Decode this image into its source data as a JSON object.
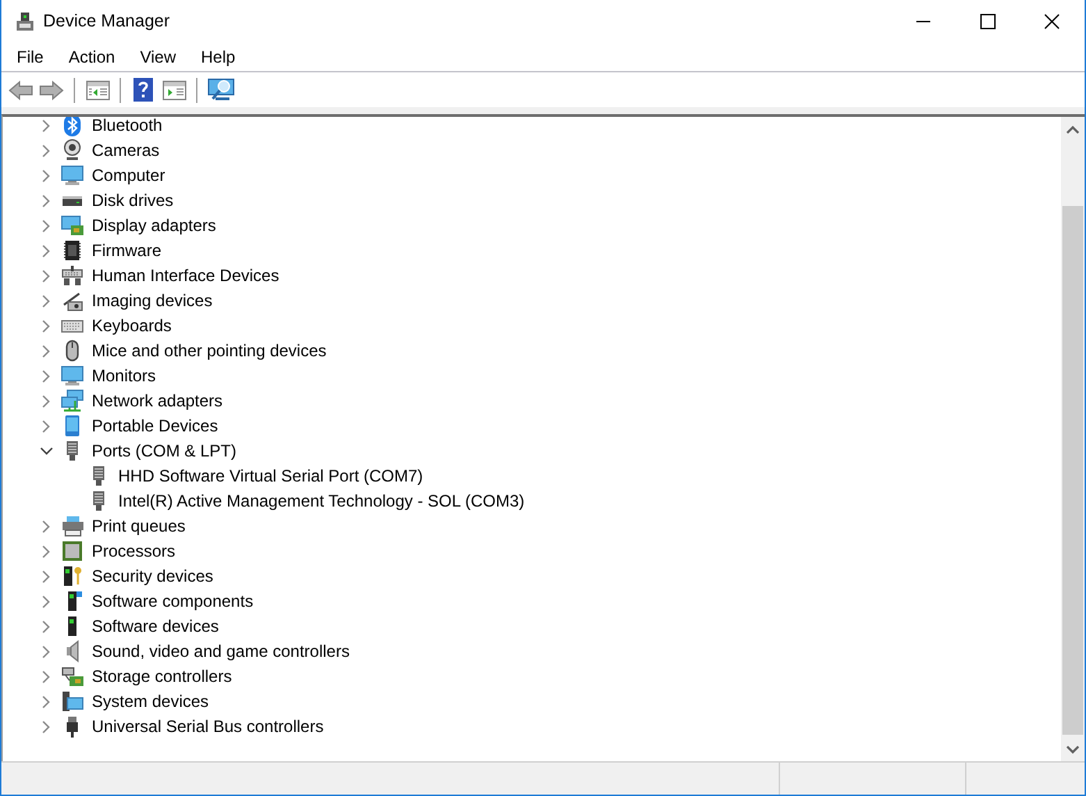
{
  "window": {
    "title": "Device Manager"
  },
  "menu": [
    "File",
    "Action",
    "View",
    "Help"
  ],
  "tree": [
    {
      "label": "Bluetooth",
      "expanded": false,
      "selected": false
    },
    {
      "label": "Cameras",
      "expanded": false,
      "selected": false
    },
    {
      "label": "Computer",
      "expanded": false,
      "selected": false
    },
    {
      "label": "Disk drives",
      "expanded": false,
      "selected": false
    },
    {
      "label": "Display adapters",
      "expanded": false,
      "selected": false
    },
    {
      "label": "Firmware",
      "expanded": false,
      "selected": false
    },
    {
      "label": "Human Interface Devices",
      "expanded": false,
      "selected": false
    },
    {
      "label": "Imaging devices",
      "expanded": false,
      "selected": false
    },
    {
      "label": "Keyboards",
      "expanded": false,
      "selected": false
    },
    {
      "label": "Mice and other pointing devices",
      "expanded": false,
      "selected": false
    },
    {
      "label": "Monitors",
      "expanded": false,
      "selected": false
    },
    {
      "label": "Network adapters",
      "expanded": false,
      "selected": false
    },
    {
      "label": "Portable Devices",
      "expanded": false,
      "selected": false
    },
    {
      "label": "Ports (COM & LPT)",
      "expanded": true,
      "selected": false,
      "children": [
        {
          "label": "HHD Software Virtual Serial Port (COM7)",
          "selected": false
        },
        {
          "label": "Intel(R) Active Management Technology - SOL (COM3)",
          "selected": false
        }
      ]
    },
    {
      "label": "Print queues",
      "expanded": false,
      "selected": false
    },
    {
      "label": "Processors",
      "expanded": false,
      "selected": false
    },
    {
      "label": "Security devices",
      "expanded": false,
      "selected": false
    },
    {
      "label": "Software components",
      "expanded": false,
      "selected": false
    },
    {
      "label": "Software devices",
      "expanded": false,
      "selected": false
    },
    {
      "label": "Sound, video and game controllers",
      "expanded": false,
      "selected": false
    },
    {
      "label": "Storage controllers",
      "expanded": false,
      "selected": false
    },
    {
      "label": "System devices",
      "expanded": false,
      "selected": false
    },
    {
      "label": "Universal Serial Bus controllers",
      "expanded": false,
      "selected": false
    }
  ]
}
